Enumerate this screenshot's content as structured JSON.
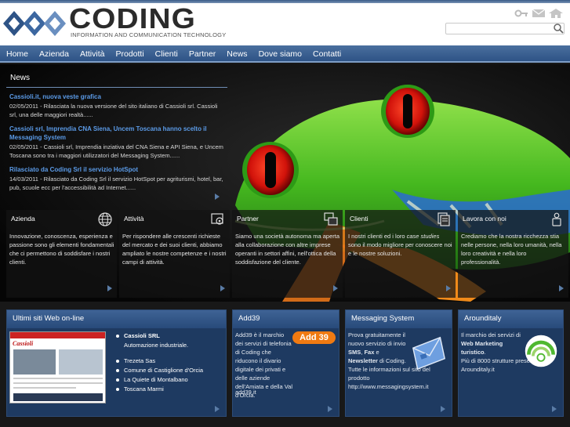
{
  "header": {
    "logo_text": "CODING",
    "tagline": "INFORMATION AND COMMUNICATION TECHNOLOGY",
    "search_placeholder": "",
    "icons": [
      "key-icon",
      "mail-icon",
      "home-icon"
    ]
  },
  "nav": {
    "items": [
      "Home",
      "Azienda",
      "Attività",
      "Prodotti",
      "Clienti",
      "Partner",
      "News",
      "Dove siamo",
      "Contatti"
    ]
  },
  "news": {
    "heading": "News",
    "items": [
      {
        "title": "Cassioli.it, nuova veste grafica",
        "date": "02/05/2011",
        "body": " - Rilasciata la nuova versione del sito italiano di Cassioli srl. Cassioli srl, una delle maggiori realtà......"
      },
      {
        "title": "Cassioli srl, Imprendia CNA Siena, Uncem Toscana hanno scelto il Messaging System",
        "date": "02/05/2011",
        "body": " - Cassioli srl, Imprendia inziativa del CNA Siena e API Siena, e Uncem Toscana sono tra i maggiori utilizzatori del Messaging System......"
      },
      {
        "title": "Rilasciato da Coding Srl il servizio HotSpot",
        "date": "14/03/2011",
        "body": " - Rilasciato da Coding Srl il servizio HotSpot per agriturismi, hotel, bar, pub, scuole ecc per l'accessibilità ad Internet......"
      }
    ]
  },
  "features": [
    {
      "title": "Azienda",
      "icon": "globe-icon",
      "text": "Innovazione, conoscenza, esperienza e passione sono gli elementi fondamentali che ci permettono di soddisfare i nostri clienti."
    },
    {
      "title": "Attività",
      "icon": "gears-icon",
      "text": "Per rispondere alle crescenti richieste del mercato e dei suoi clienti, abbiamo ampliato le nostre competenze e i nostri campi di attività."
    },
    {
      "title": "Partner",
      "icon": "windows-icon",
      "text": "Siamo una società autonoma ma aperta alla collaborazione con altre imprese operanti in settori affini, nell'ottica della soddisfazione del cliente."
    },
    {
      "title": "Clienti",
      "icon": "documents-icon",
      "text_before": "I nostri clienti ed i loro ",
      "text_italic": "case studies",
      "text_after": " sono il modo migliore per conoscere noi e le nostre soluzioni."
    },
    {
      "title": "Lavora con noi",
      "icon": "person-icon",
      "text": "Crediamo che la nostra ricchezza stia nelle persone, nella loro umanità, nella loro creatività e nella loro professionalità."
    }
  ],
  "bottom": {
    "sites": {
      "heading": "Ultimi siti Web on-line",
      "thumb_label": "Cassioli",
      "items": [
        {
          "name": "Cassioli SRL",
          "sub": "Automazione industriale."
        },
        {
          "name": "Trezeta Sas"
        },
        {
          "name": "Comune di Castiglione d'Orcia"
        },
        {
          "name": "La Quiete di Montalbano"
        },
        {
          "name": "Toscana Marmi"
        }
      ]
    },
    "add39": {
      "heading": "Add39",
      "logo_text": "Add 39",
      "text": "Add39 è il marchio dei servizi di telefonia di Coding che riducono il divario digitale dei privati e delle aziende dell'Amiata e della Val d'Orcia.",
      "link": "add39.it"
    },
    "messaging": {
      "heading": "Messaging System",
      "p1_a": "Prova gratuitamente il nuovo servizio di invio ",
      "sms": "SMS",
      "comma": ", ",
      "fax": "Fax",
      "and": " e ",
      "newsletter": "Newsletter",
      "p1_b": " di Coding.",
      "p2": "Tutte le informazioni sul sito del prodotto",
      "link": "http://www.messagingsystem.it"
    },
    "arounditaly": {
      "heading": "Arounditaly",
      "p1": "Il marchio dei servizi di ",
      "bold": "Web Marketing turistico",
      "p1_end": ".",
      "p2": "Più di 8000 strutture presenti su Arounditaly.it"
    }
  },
  "colors": {
    "nav": "#2e5386",
    "link": "#5b9be8",
    "box": "#1e3a61"
  }
}
